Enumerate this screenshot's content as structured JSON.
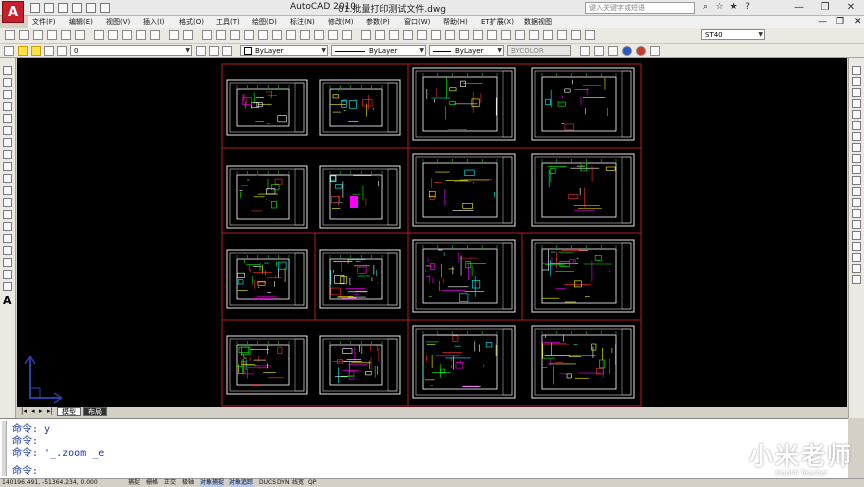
{
  "title_bar": {
    "app_title": "AutoCAD 2010",
    "doc_title": "01.批量打印测试文件.dwg",
    "search_placeholder": "键入关键字或短语",
    "window_buttons": [
      "—",
      "❐",
      "✕"
    ]
  },
  "menu": [
    "文件(F)",
    "编辑(E)",
    "视图(V)",
    "插入(I)",
    "格式(O)",
    "工具(T)",
    "绘图(D)",
    "标注(N)",
    "修改(M)",
    "参数(P)",
    "窗口(W)",
    "帮助(H)",
    "ET扩展(X)",
    "数据视图"
  ],
  "toolbar1": {
    "style_dropdown": "ST40"
  },
  "toolbar2": {
    "layer_value": "0",
    "color_value": "ByLayer",
    "linetype_value": "ByLayer",
    "lineweight_value": "ByLayer",
    "plotstyle_value": "BYCOLOR"
  },
  "tabs": [
    "模型",
    "布局"
  ],
  "command_lines": [
    "命令: y",
    "命令:",
    "命令: '_.zoom _e",
    "命令:"
  ],
  "status": {
    "coords": "140196.491, -51364.234, 0.000",
    "buttons": [
      "捕捉",
      "栅格",
      "正交",
      "极轴",
      "对象捕捉",
      "对象追踪",
      "DUCS",
      "DYN",
      "线宽",
      "QP"
    ]
  },
  "watermark": {
    "brand": "小米老师",
    "brand_en": "XiaoMi Teacher"
  }
}
